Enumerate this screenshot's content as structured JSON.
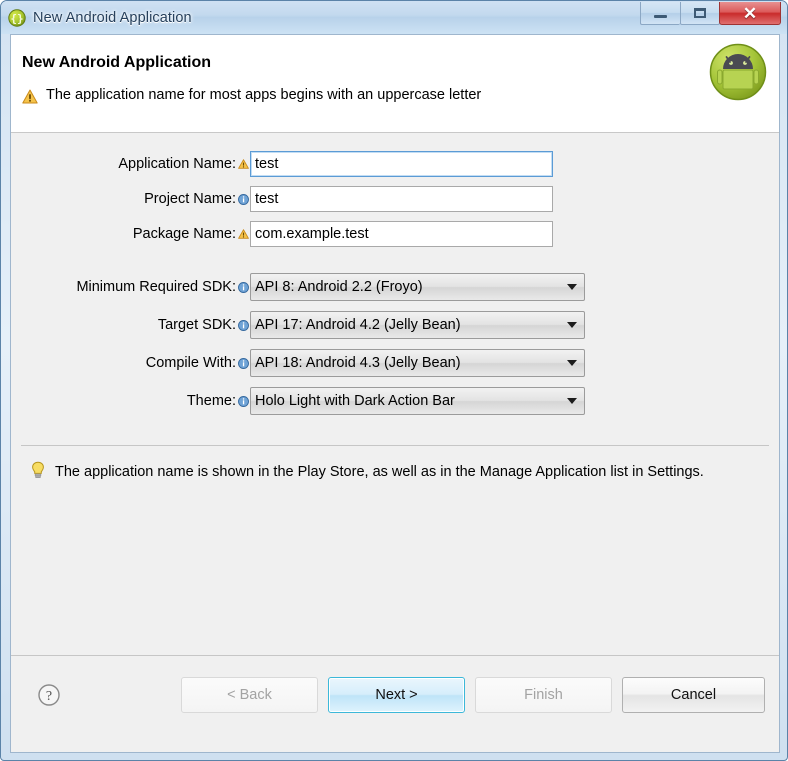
{
  "window": {
    "title": "New Android Application",
    "icon": "android-braces-icon",
    "controls": {
      "minimize_label": "Minimize",
      "maximize_label": "Maximize",
      "close_label": "Close"
    }
  },
  "header": {
    "title": "New Android Application",
    "message": "The application name for most apps begins with an uppercase letter",
    "message_icon": "warning-icon",
    "logo_icon": "android-robot-icon"
  },
  "form": {
    "fields": [
      {
        "label": "Application Name:",
        "value": "test",
        "decorator": "warning-icon",
        "type": "text",
        "focused": true
      },
      {
        "label": "Project Name:",
        "value": "test",
        "decorator": "info-icon",
        "type": "text",
        "focused": false
      },
      {
        "label": "Package Name:",
        "value": "com.example.test",
        "decorator": "warning-icon",
        "type": "text",
        "focused": false
      },
      {
        "label": "Minimum Required SDK:",
        "value": "API 8: Android 2.2 (Froyo)",
        "decorator": "info-icon",
        "type": "combo",
        "focused": false
      },
      {
        "label": "Target SDK:",
        "value": "API 17: Android 4.2 (Jelly Bean)",
        "decorator": "info-icon",
        "type": "combo",
        "focused": false
      },
      {
        "label": "Compile With:",
        "value": "API 18: Android 4.3 (Jelly Bean)",
        "decorator": "info-icon",
        "type": "combo",
        "focused": false
      },
      {
        "label": "Theme:",
        "value": "Holo Light with Dark Action Bar",
        "decorator": "info-icon",
        "type": "combo",
        "focused": false
      }
    ]
  },
  "hint": {
    "icon": "lightbulb-icon",
    "text": "The application name is shown in the Play Store, as well as in the Manage Application list in Settings."
  },
  "footer": {
    "help_icon": "help-question-icon",
    "buttons": [
      {
        "label": "< Back",
        "state": "disabled"
      },
      {
        "label": "Next >",
        "state": "default"
      },
      {
        "label": "Finish",
        "state": "disabled"
      },
      {
        "label": "Cancel",
        "state": "normal"
      }
    ]
  },
  "colors": {
    "accent": "#3cb8d9",
    "warning": "#e8a33d",
    "info": "#4a7fb5",
    "android_green": "#a4c639",
    "close_red": "#c92b2b"
  }
}
